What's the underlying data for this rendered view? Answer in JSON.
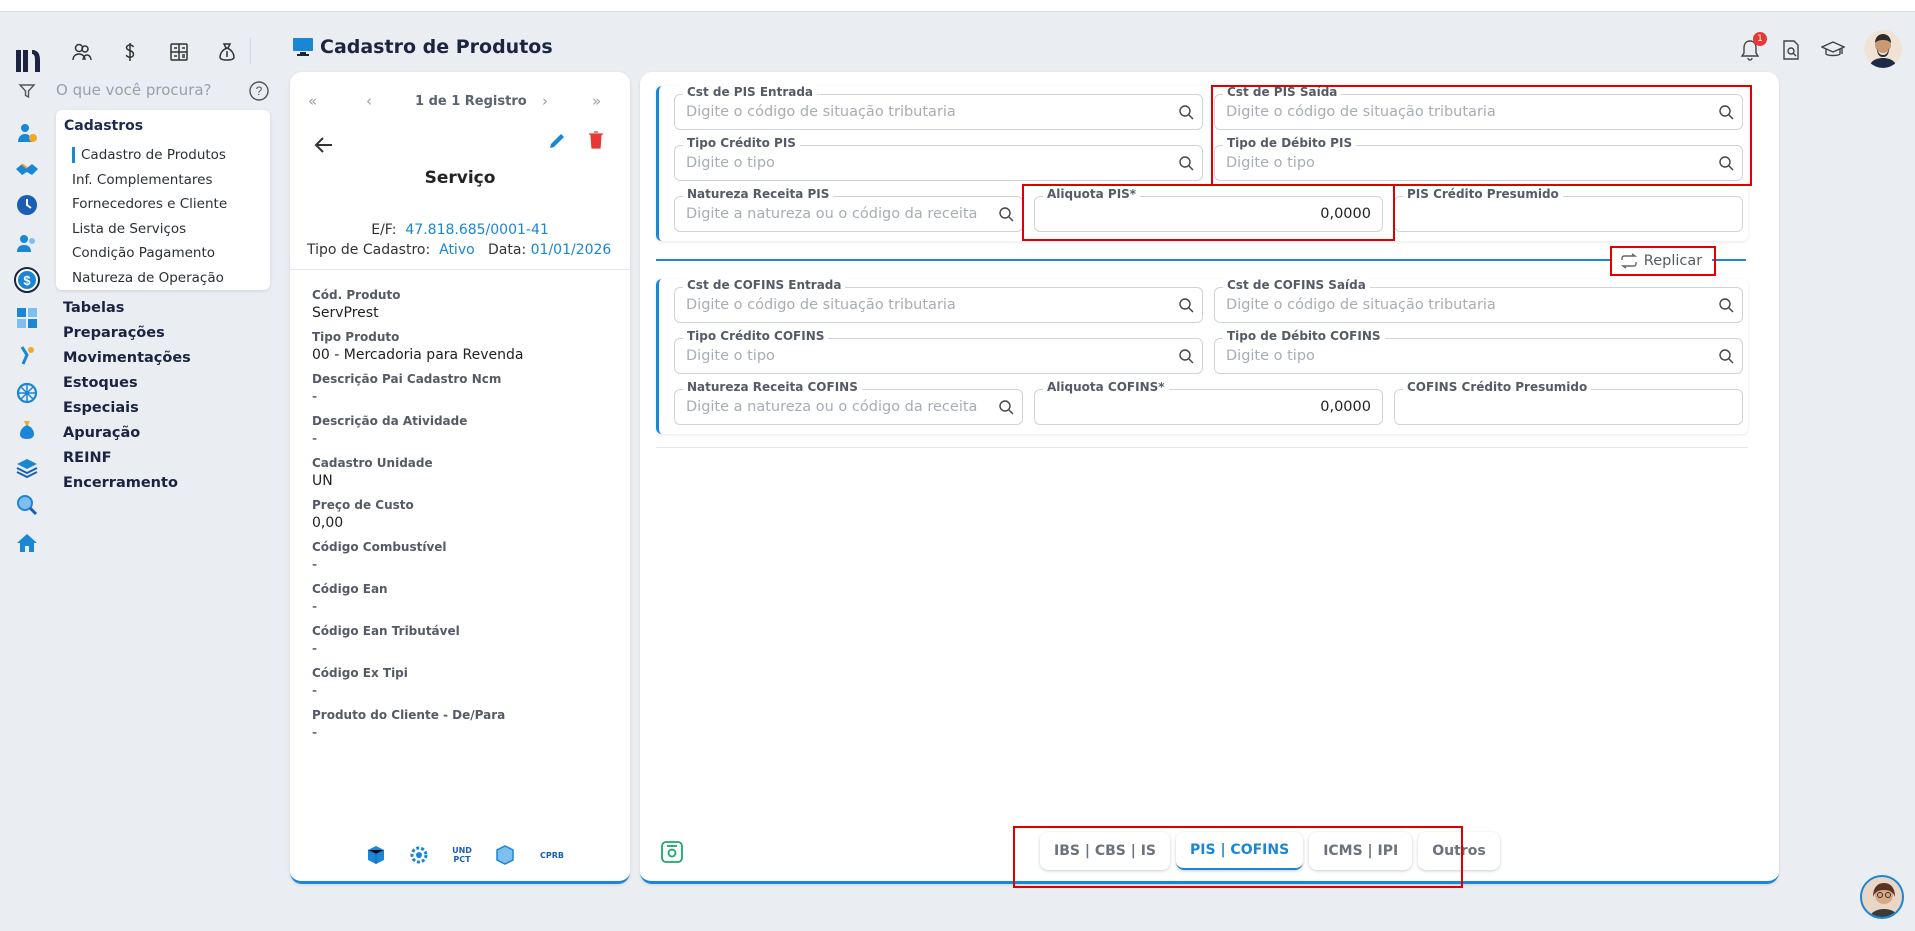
{
  "header": {
    "title": "Cadastro de Produtos",
    "notification_count": "1",
    "search_placeholder": "O que você procura?"
  },
  "menu": {
    "section": "Cadastros",
    "items": [
      "Cadastro de Produtos",
      "Inf. Complementares",
      "Fornecedores e Cliente",
      "Lista de Serviços",
      "Condição Pagamento",
      "Natureza de Operação"
    ],
    "groups": [
      "Tabelas",
      "Preparações",
      "Movimentações",
      "Estoques",
      "Especiais",
      "Apuração",
      "REINF",
      "Encerramento"
    ]
  },
  "product": {
    "pager": "1 de 1 Registro",
    "name": "Serviço",
    "ef_label": "E/F:",
    "ef_value": "47.818.685/0001-41",
    "tipo_label": "Tipo de Cadastro:",
    "tipo_value": "Ativo",
    "data_label": "Data:",
    "data_value": "01/01/2026",
    "fields": [
      {
        "label": "Cód. Produto",
        "value": "ServPrest"
      },
      {
        "label": "Tipo Produto",
        "value": "00 - Mercadoria para Revenda"
      },
      {
        "label": "Descrição Pai Cadastro Ncm",
        "value": "-"
      },
      {
        "label": "Descrição da Atividade",
        "value": "-"
      },
      {
        "label": "Cadastro Unidade",
        "value": "UN"
      },
      {
        "label": "Preço de Custo",
        "value": "0,00"
      },
      {
        "label": "Código Combustível",
        "value": "-"
      },
      {
        "label": "Código Ean",
        "value": "-"
      },
      {
        "label": "Código Ean Tributável",
        "value": "-"
      },
      {
        "label": "Código Ex Tipi",
        "value": "-"
      },
      {
        "label": "Produto do Cliente - De/Para",
        "value": "-"
      }
    ],
    "bottom_icons": {
      "und_pct_top": "UND",
      "und_pct_bottom": "PCT",
      "cprb": "CPRB"
    }
  },
  "pis": {
    "cst_entrada": {
      "label": "Cst de PIS Entrada",
      "placeholder": "Digite o código de situação tributaria"
    },
    "cst_saida": {
      "label": "Cst de PIS Saída",
      "placeholder": "Digite o código de situação tributaria"
    },
    "tipo_credito": {
      "label": "Tipo Crédito PIS",
      "placeholder": "Digite o tipo"
    },
    "tipo_debito": {
      "label": "Tipo de Débito PIS",
      "placeholder": "Digite o tipo"
    },
    "natureza": {
      "label": "Natureza Receita PIS",
      "placeholder": "Digite a natureza ou o código da receita"
    },
    "aliquota": {
      "label": "Aliquota PIS*",
      "value": "0,0000"
    },
    "credito_presumido": {
      "label": "PIS Crédito Presumido"
    }
  },
  "replicar_label": "Replicar",
  "cofins": {
    "cst_entrada": {
      "label": "Cst de COFINS Entrada",
      "placeholder": "Digite o código de situação tributaria"
    },
    "cst_saida": {
      "label": "Cst de COFINS Saída",
      "placeholder": "Digite o código de situação tributaria"
    },
    "tipo_credito": {
      "label": "Tipo Crédito COFINS",
      "placeholder": "Digite o tipo"
    },
    "tipo_debito": {
      "label": "Tipo de Débito COFINS",
      "placeholder": "Digite o tipo"
    },
    "natureza": {
      "label": "Natureza Receita COFINS",
      "placeholder": "Digite a natureza ou o código da receita"
    },
    "aliquota": {
      "label": "Aliquota COFINS*",
      "value": "0,0000"
    },
    "credito_presumido": {
      "label": "COFINS Crédito Presumido"
    }
  },
  "tabs": [
    "IBS | CBS | IS",
    "PIS | COFINS",
    "ICMS | IPI",
    "Outros"
  ],
  "colors": {
    "accent": "#1a86d6",
    "highlight": "#e00000",
    "delete": "#e53935"
  }
}
